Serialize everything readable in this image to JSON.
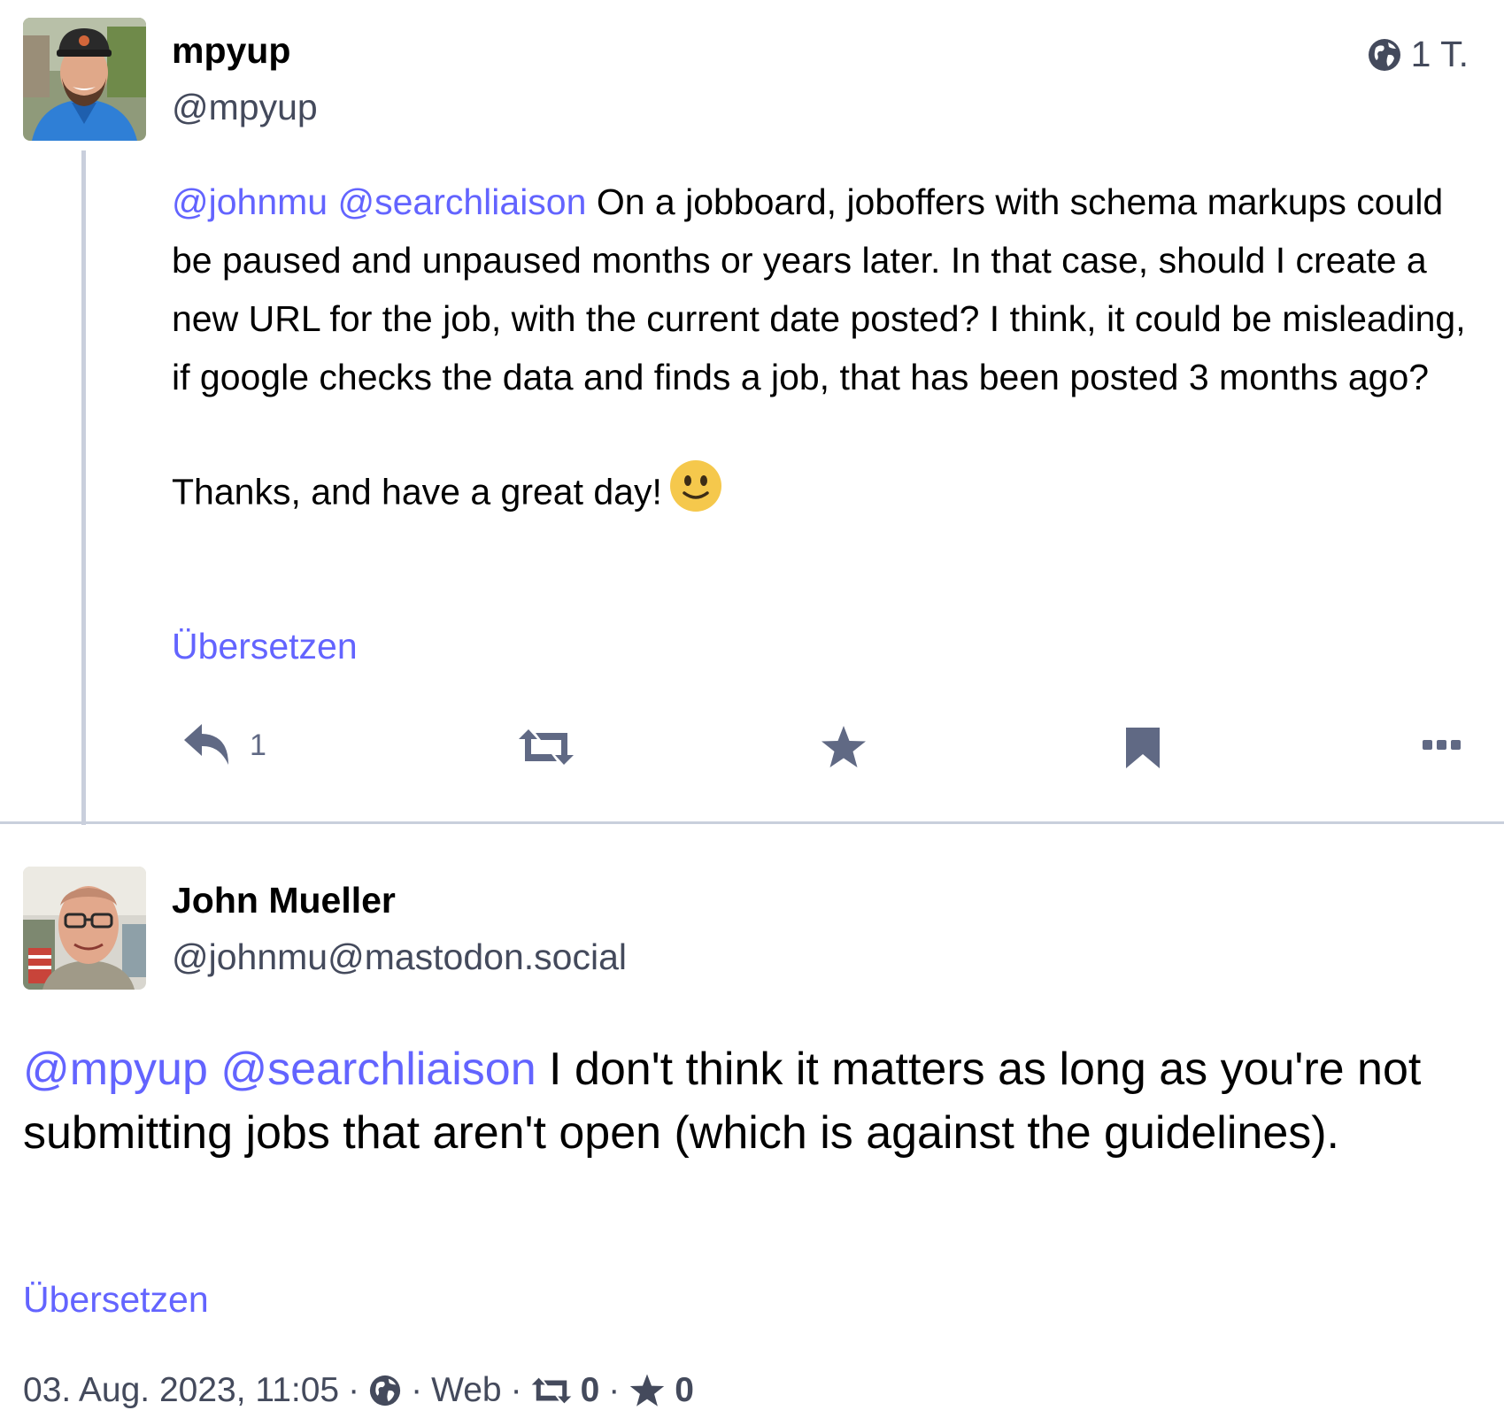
{
  "colors": {
    "accent": "#6364ff",
    "icon_gray": "#606984",
    "handle_gray": "#444a5c",
    "thread_line": "#c9cfdc",
    "emoji_yellow": "#f5c84c"
  },
  "post1": {
    "avatar_icon": "user-photo-mpyup",
    "display_name": "mpyup",
    "handle": "@mpyup",
    "visibility_icon": "globe-icon",
    "time": "1 T.",
    "mention1": "@johnmu",
    "mention2": "@searchliaison",
    "text_part1": " On a jobboard, joboffers with schema markups could be paused and unpaused months or years later. In that case, should I create a new URL for the job, with the current date posted? I think, it could be misleading, if google checks the data and finds a job, that has been posted 3 months ago?",
    "text_part2": "Thanks, and have a great day!",
    "emoji_icon": "slightly-smiling-face-icon",
    "translate": "Übersetzen",
    "actions": {
      "reply_icon": "reply-icon",
      "reply_count": "1",
      "boost_icon": "boost-icon",
      "favourite_icon": "star-icon",
      "bookmark_icon": "bookmark-icon",
      "more_icon": "more-icon"
    }
  },
  "post2": {
    "avatar_icon": "user-photo-johnmu",
    "display_name": "John Mueller",
    "handle": "@johnmu@mastodon.social",
    "mention1": "@mpyup",
    "mention2": "@searchliaison",
    "text": " I don't think it matters as long as you're not submitting jobs that aren't open (which is against the guidelines).",
    "translate": "Übersetzen",
    "meta": {
      "date": "03. Aug. 2023, 11:05",
      "sep": "·",
      "visibility_icon": "globe-icon",
      "client": "Web",
      "boost_icon": "boost-icon",
      "boost_count": "0",
      "favourite_icon": "star-icon",
      "favourite_count": "0"
    }
  }
}
